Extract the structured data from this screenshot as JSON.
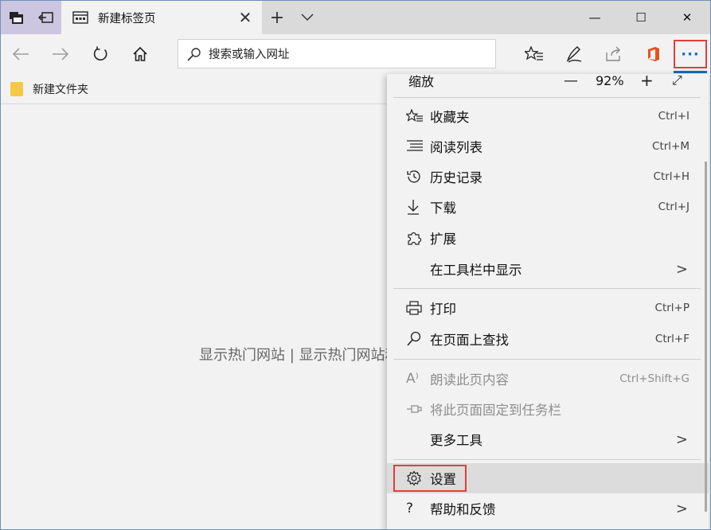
{
  "tab": {
    "title": "新建标签页",
    "close": "✕"
  },
  "titlebar": {
    "new_tab": "+",
    "tabs_menu": "⌵",
    "minimize": "—",
    "maximize": "☐",
    "close": "✕"
  },
  "address": {
    "placeholder": "搜索或输入网址"
  },
  "favorites_bar": {
    "folder_label": "新建文件夹"
  },
  "page": {
    "hot_sites": "显示热门网站 | 显示热门网站和我的资讯源"
  },
  "more_button": {
    "label": "···"
  },
  "menu": {
    "zoom": {
      "label": "缩放",
      "minus": "—",
      "value": "92%",
      "plus": "+",
      "fullscreen": "⤢"
    },
    "items": [
      {
        "label": "收藏夹",
        "shortcut": "Ctrl+I",
        "icon": "☆≡"
      },
      {
        "label": "阅读列表",
        "shortcut": "Ctrl+M",
        "icon": "☰"
      },
      {
        "label": "历史记录",
        "shortcut": "Ctrl+H",
        "icon": "↺"
      },
      {
        "label": "下载",
        "shortcut": "Ctrl+J",
        "icon": "↓"
      },
      {
        "label": "扩展",
        "shortcut": "",
        "icon": "⚙"
      },
      {
        "label": "在工具栏中显示",
        "shortcut": "",
        "icon": "",
        "arrow": ">"
      },
      {
        "label": "打印",
        "shortcut": "Ctrl+P",
        "icon": "⎙"
      },
      {
        "label": "在页面上查找",
        "shortcut": "Ctrl+F",
        "icon": "⌕"
      },
      {
        "label": "朗读此页内容",
        "shortcut": "Ctrl+Shift+G",
        "icon": "A⁾"
      },
      {
        "label": "将此页面固定到任务栏",
        "shortcut": "",
        "icon": "⊸"
      },
      {
        "label": "更多工具",
        "shortcut": "",
        "icon": "",
        "arrow": ">"
      },
      {
        "label": "设置",
        "shortcut": "",
        "icon": "⚙"
      },
      {
        "label": "帮助和反馈",
        "shortcut": "",
        "icon": "?",
        "arrow": ">"
      }
    ]
  },
  "colors": {
    "accent": "#0f6cc4",
    "highlight_border": "#e0403a",
    "folder": "#f6c944"
  }
}
